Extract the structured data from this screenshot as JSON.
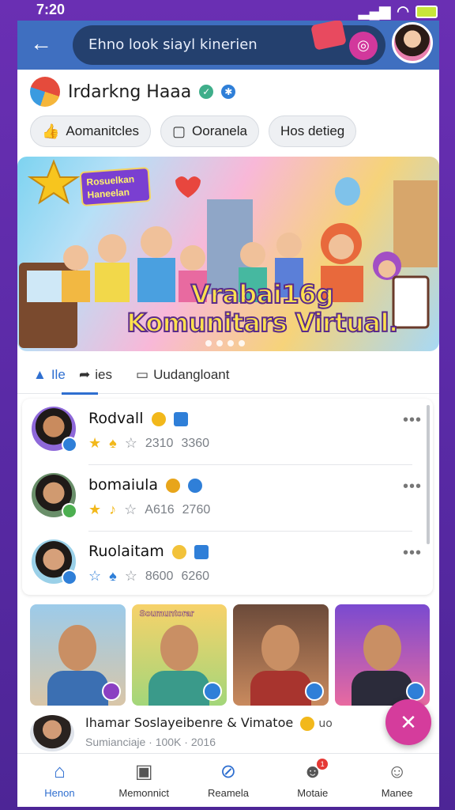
{
  "status": {
    "time": "7:20",
    "signal": "signal-icon",
    "wifi": "wifi-icon",
    "battery": "battery-icon"
  },
  "appbar": {
    "search_text": "Ehno look siayl kinerien"
  },
  "profile": {
    "name": "Irdarkng Haaa"
  },
  "chips": [
    "Aomanitcles",
    "Ooranela",
    "Hos detieg"
  ],
  "banner": {
    "badge_text": "Rosuelkan\nHaneelan",
    "title_line1": "Vrabai16g",
    "title_line2": "Komunitars Virtual."
  },
  "tabs": [
    "Ile",
    "ies",
    "Uudangloant"
  ],
  "members": [
    {
      "name": "Rodvall",
      "stat1": "2310",
      "stat2": "3360"
    },
    {
      "name": "bomaiula",
      "stat1": "A616",
      "stat2": "2760"
    },
    {
      "name": "Ruolaitam",
      "stat1": "8600",
      "stat2": "6260"
    }
  ],
  "gallery": {
    "label": "Soumuntorar"
  },
  "post": {
    "title": "Ihamar  Soslayeibenre   & Vimatoe",
    "sub_text": "Sumianciaje · 100K · 2016",
    "tag": "uo"
  },
  "nav": [
    {
      "label": "Henon",
      "icon": "home-icon"
    },
    {
      "label": "Memonnict",
      "icon": "calendar-icon"
    },
    {
      "label": "Reamela",
      "icon": "compass-icon"
    },
    {
      "label": "Motaie",
      "icon": "people-icon",
      "badge": "1"
    },
    {
      "label": "Manee",
      "icon": "profile-icon"
    }
  ],
  "colors": {
    "appbar": "#3f6fc0",
    "accent": "#2f6fd0",
    "fab": "#d53c9c",
    "background": "#6a2fb3"
  }
}
